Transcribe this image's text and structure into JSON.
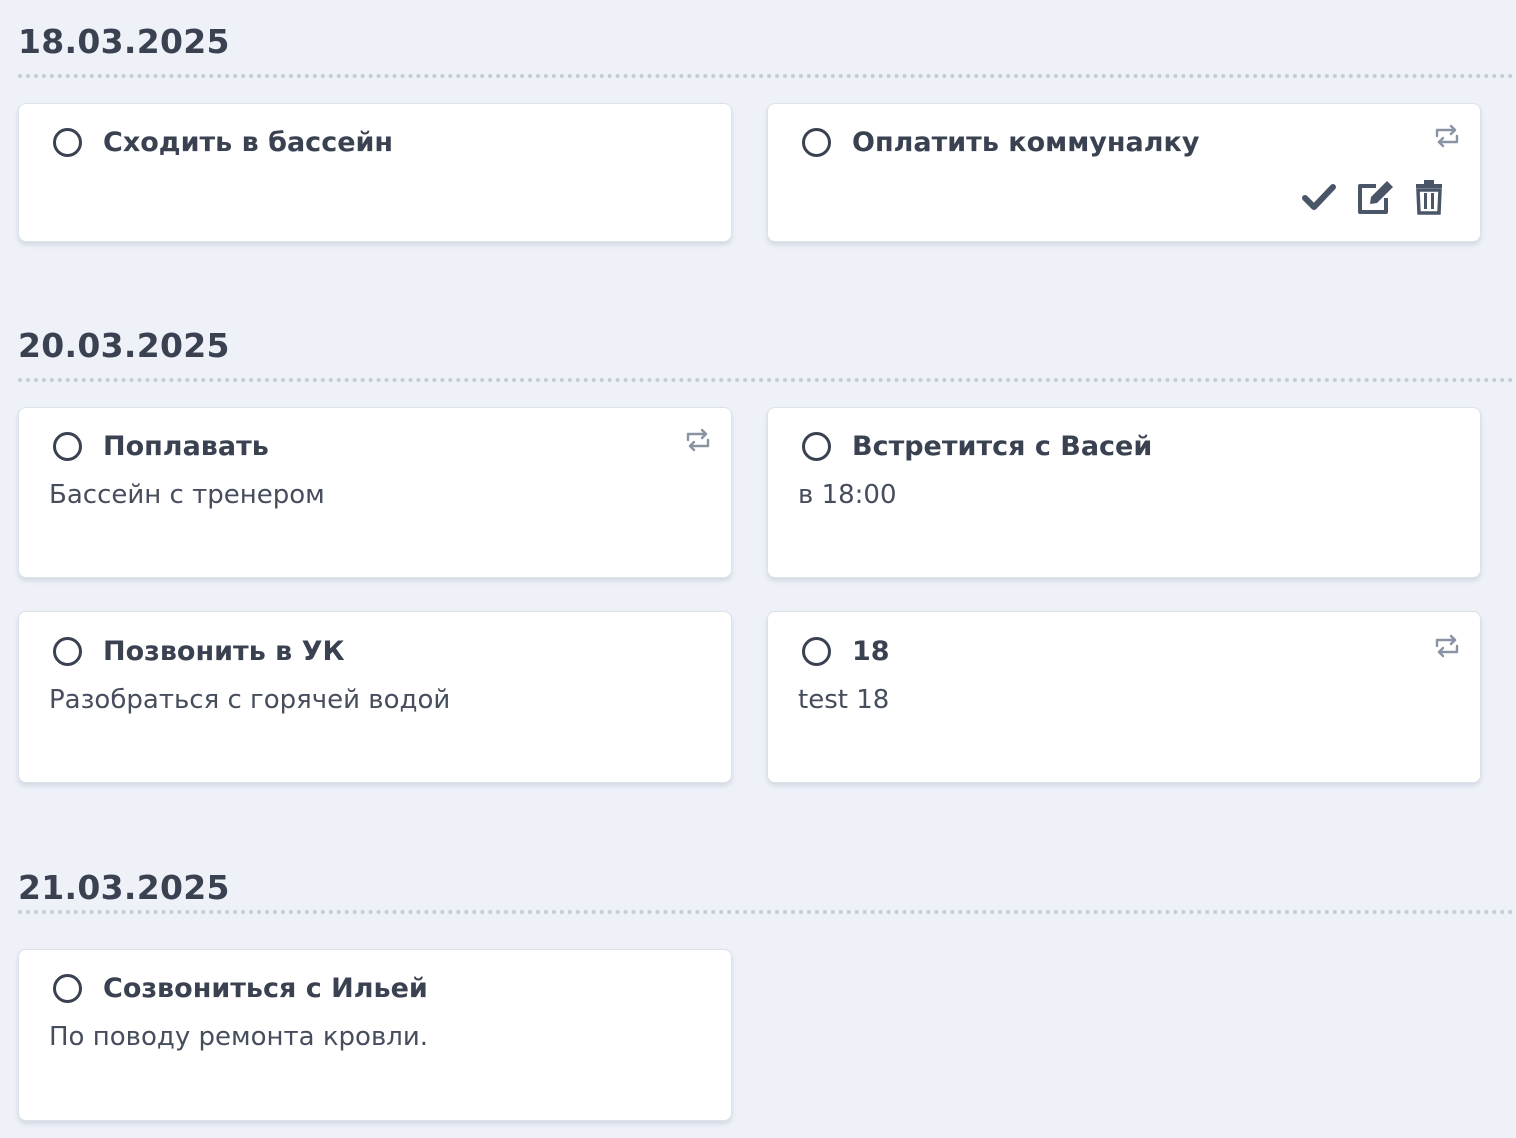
{
  "groups": [
    {
      "date": "18.03.2025",
      "tasks": [
        {
          "title": "Сходить в бассейн",
          "description": ""
        },
        {
          "title": "Оплатить коммуналку",
          "description": "",
          "repeat": true,
          "hover_actions": [
            "check-icon",
            "edit-icon",
            "trash-icon"
          ]
        }
      ]
    },
    {
      "date": "20.03.2025",
      "tasks": [
        {
          "title": "Поплавать",
          "description": "Бассейн с тренером",
          "repeat": true
        },
        {
          "title": "Встретится с Васей",
          "description": "в 18:00"
        },
        {
          "title": "Позвонить в УК",
          "description": "Разобраться с горячей водой"
        },
        {
          "title": "18",
          "description": "test 18",
          "repeat": true
        }
      ]
    },
    {
      "date": "21.03.2025",
      "tasks": [
        {
          "title": "Созвониться с Ильей",
          "description": "По поводу ремонта кровли."
        }
      ]
    }
  ],
  "icons": {
    "repeat": "repeat-icon",
    "complete": "check-icon",
    "edit": "edit-icon",
    "delete": "trash-icon",
    "status": "circle-outline-icon"
  },
  "colors": {
    "background": "#eef1f8",
    "card": "#ffffff",
    "text": "#3a4150",
    "icon_muted": "#8a93a3",
    "icon_dark": "#4a5568"
  }
}
